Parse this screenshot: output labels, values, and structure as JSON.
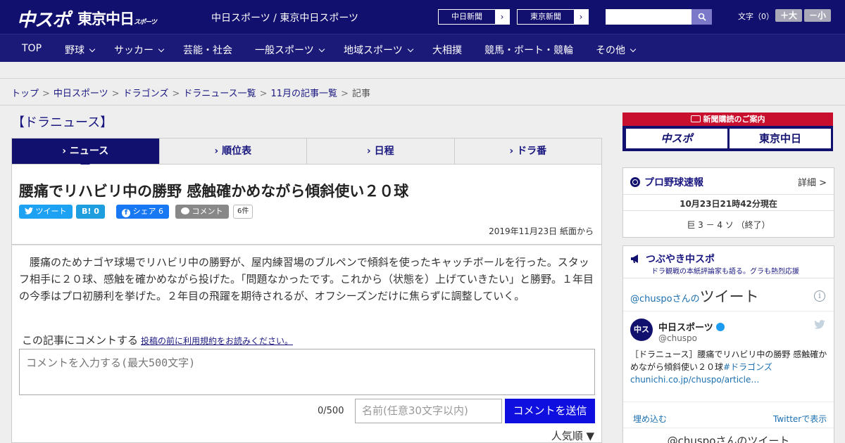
{
  "header": {
    "logo_chuspo": "中スポ",
    "logo_tokyo": "東京中日",
    "logo_tokyo_small": "スポーツ",
    "site_links": "中日スポーツ / 東京中日スポーツ",
    "ext_buttons": [
      {
        "label": "中日新聞"
      },
      {
        "label": "東京新聞"
      }
    ],
    "font_size_label": "文字（0）",
    "font_plus": "＋大",
    "font_minus": "－小"
  },
  "nav": {
    "items": [
      {
        "label": "TOP",
        "dropdown": false
      },
      {
        "label": "野球",
        "dropdown": true
      },
      {
        "label": "サッカー",
        "dropdown": true
      },
      {
        "label": "芸能・社会",
        "dropdown": false
      },
      {
        "label": "一般スポーツ",
        "dropdown": true
      },
      {
        "label": "地域スポーツ",
        "dropdown": true
      },
      {
        "label": "大相撲",
        "dropdown": false
      },
      {
        "label": "競馬・ボート・競輪",
        "dropdown": false
      },
      {
        "label": "その他",
        "dropdown": true
      }
    ]
  },
  "breadcrumb": {
    "items": [
      "トップ",
      "中日スポーツ",
      "ドラゴンズ",
      "ドラニュース一覧",
      "11月の記事一覧"
    ],
    "current": "記事",
    "separator": ">"
  },
  "section_title": "【ドラニュース】",
  "tabs": [
    {
      "label": "ニュース",
      "active": true
    },
    {
      "label": "順位表",
      "active": false
    },
    {
      "label": "日程",
      "active": false
    },
    {
      "label": "ドラ番",
      "active": false
    }
  ],
  "article": {
    "headline": "腰痛でリハビリ中の勝野 感触確かめながら傾斜使い２０球",
    "share": {
      "tweet": "ツイート",
      "hatena": "B! 0",
      "facebook": "シェア 6",
      "comment": "コメント",
      "comment_count": "6件"
    },
    "dateline": "2019年11月23日 紙面から",
    "body": "腰痛のためナゴヤ球場でリハビリ中の勝野が、屋内練習場のブルペンで傾斜を使ったキャッチボールを行った。スタッフ相手に２０球、感触を確かめながら投げた。「問題なかったです。これから（状態を）上げていきたい」と勝野。１年目の今季はプロ初勝利を挙げた。２年目の飛躍を期待されるが、オフシーズンだけに焦らずに調整していく。"
  },
  "comments": {
    "label": "この記事にコメントする",
    "terms_link": "投稿の前に利用規約をお読みください。",
    "textarea_placeholder": "コメントを入力する(最大500文字)",
    "counter": "0/500",
    "name_placeholder": "名前(任意30文字以内)",
    "submit_label": "コメントを送信",
    "sort_label": "人気順 ▼"
  },
  "sidebar": {
    "promo": {
      "title": "新聞購読のご案内",
      "btn_chuspo": "中スポ",
      "btn_tokyo": "東京中日"
    },
    "baseball": {
      "title": "プロ野球速報",
      "detail": "詳細 >",
      "time": "10月23日21時42分現在",
      "score": "巨 3 － 4 ソ （終了）"
    },
    "tweets": {
      "title": "つぶやき中スポ",
      "subtitle": "ドラ観戦の本紙評論家も語る。グラも熱烈応援",
      "head_handle": "@chuspoさんの",
      "head_big": "ツイート",
      "avatar_text": "中スポ",
      "name": "中日スポーツ",
      "handle": "@chuspo",
      "text": "［ドラニュース］腰痛でリハビリ中の勝野 感触確かめながら傾斜使い２０球",
      "hashtag": "#ドラゴンズ",
      "link": "chunichi.co.jp/chuspo/article…",
      "embed": "埋め込む",
      "view_on_twitter": "Twitterで表示",
      "more": "@chuspoさんのツイート"
    }
  },
  "colors": {
    "navy": "#12106e",
    "nav": "#1b1a79",
    "submit": "#0f0fe0",
    "promo_red": "#c8102e",
    "twitter_blue": "#1da1f2",
    "facebook_blue": "#1877f2",
    "hatena_blue": "#1e9ede"
  }
}
